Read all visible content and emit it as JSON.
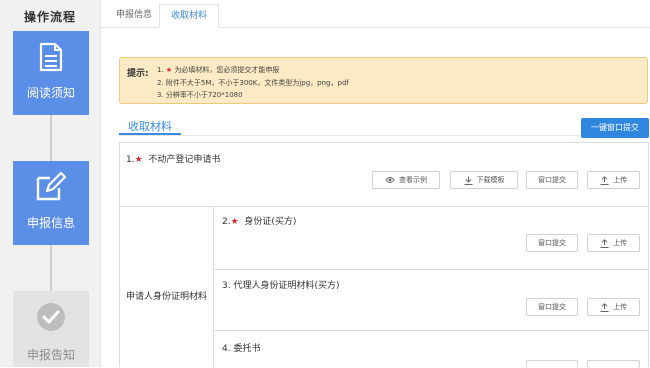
{
  "sidebar": {
    "title": "操作流程",
    "steps": [
      {
        "label": "阅读须知",
        "icon": "document-icon",
        "state": "active"
      },
      {
        "label": "申报信息",
        "icon": "edit-icon",
        "state": "active"
      },
      {
        "label": "申报告知",
        "icon": "check-circle-icon",
        "state": "inactive"
      }
    ]
  },
  "tabs": [
    {
      "label": "申报信息",
      "active": false
    },
    {
      "label": "收取材料",
      "active": true
    }
  ],
  "notice": {
    "label": "提示:",
    "lines": [
      {
        "prefix": "1.",
        "star": "★",
        "text": "为必填材料，您必须提交才能申报"
      },
      {
        "text": "2. 附件不大于5M，不小于300K，文件类型为jpg，png，pdf"
      },
      {
        "text": "3. 分辨率不小于720*1080"
      }
    ]
  },
  "section": {
    "title": "收取材料",
    "submit_all": "一键窗口提交"
  },
  "items": [
    {
      "index": "1.",
      "star": "★",
      "title": "不动产登记申请书",
      "buttons": {
        "view": "查看示例",
        "download": "下载模板",
        "window_submit": "窗口提交",
        "upload": "上传"
      }
    },
    {
      "index": "2.",
      "star": "★",
      "title": "身份证(买方)",
      "buttons": {
        "window_submit": "窗口提交",
        "upload": "上传"
      }
    },
    {
      "index": "3.",
      "title": "代理人身份证明材料(买方)",
      "buttons": {
        "window_submit": "窗口提交",
        "upload": "上传"
      }
    },
    {
      "index": "4.",
      "title": "委托书"
    }
  ],
  "group_label": "申请人身份证明材料",
  "colors": {
    "accent": "#5b8ee6",
    "primary_button": "#2f86df",
    "notice_bg": "#fbeac3",
    "star": "#e0282e"
  }
}
